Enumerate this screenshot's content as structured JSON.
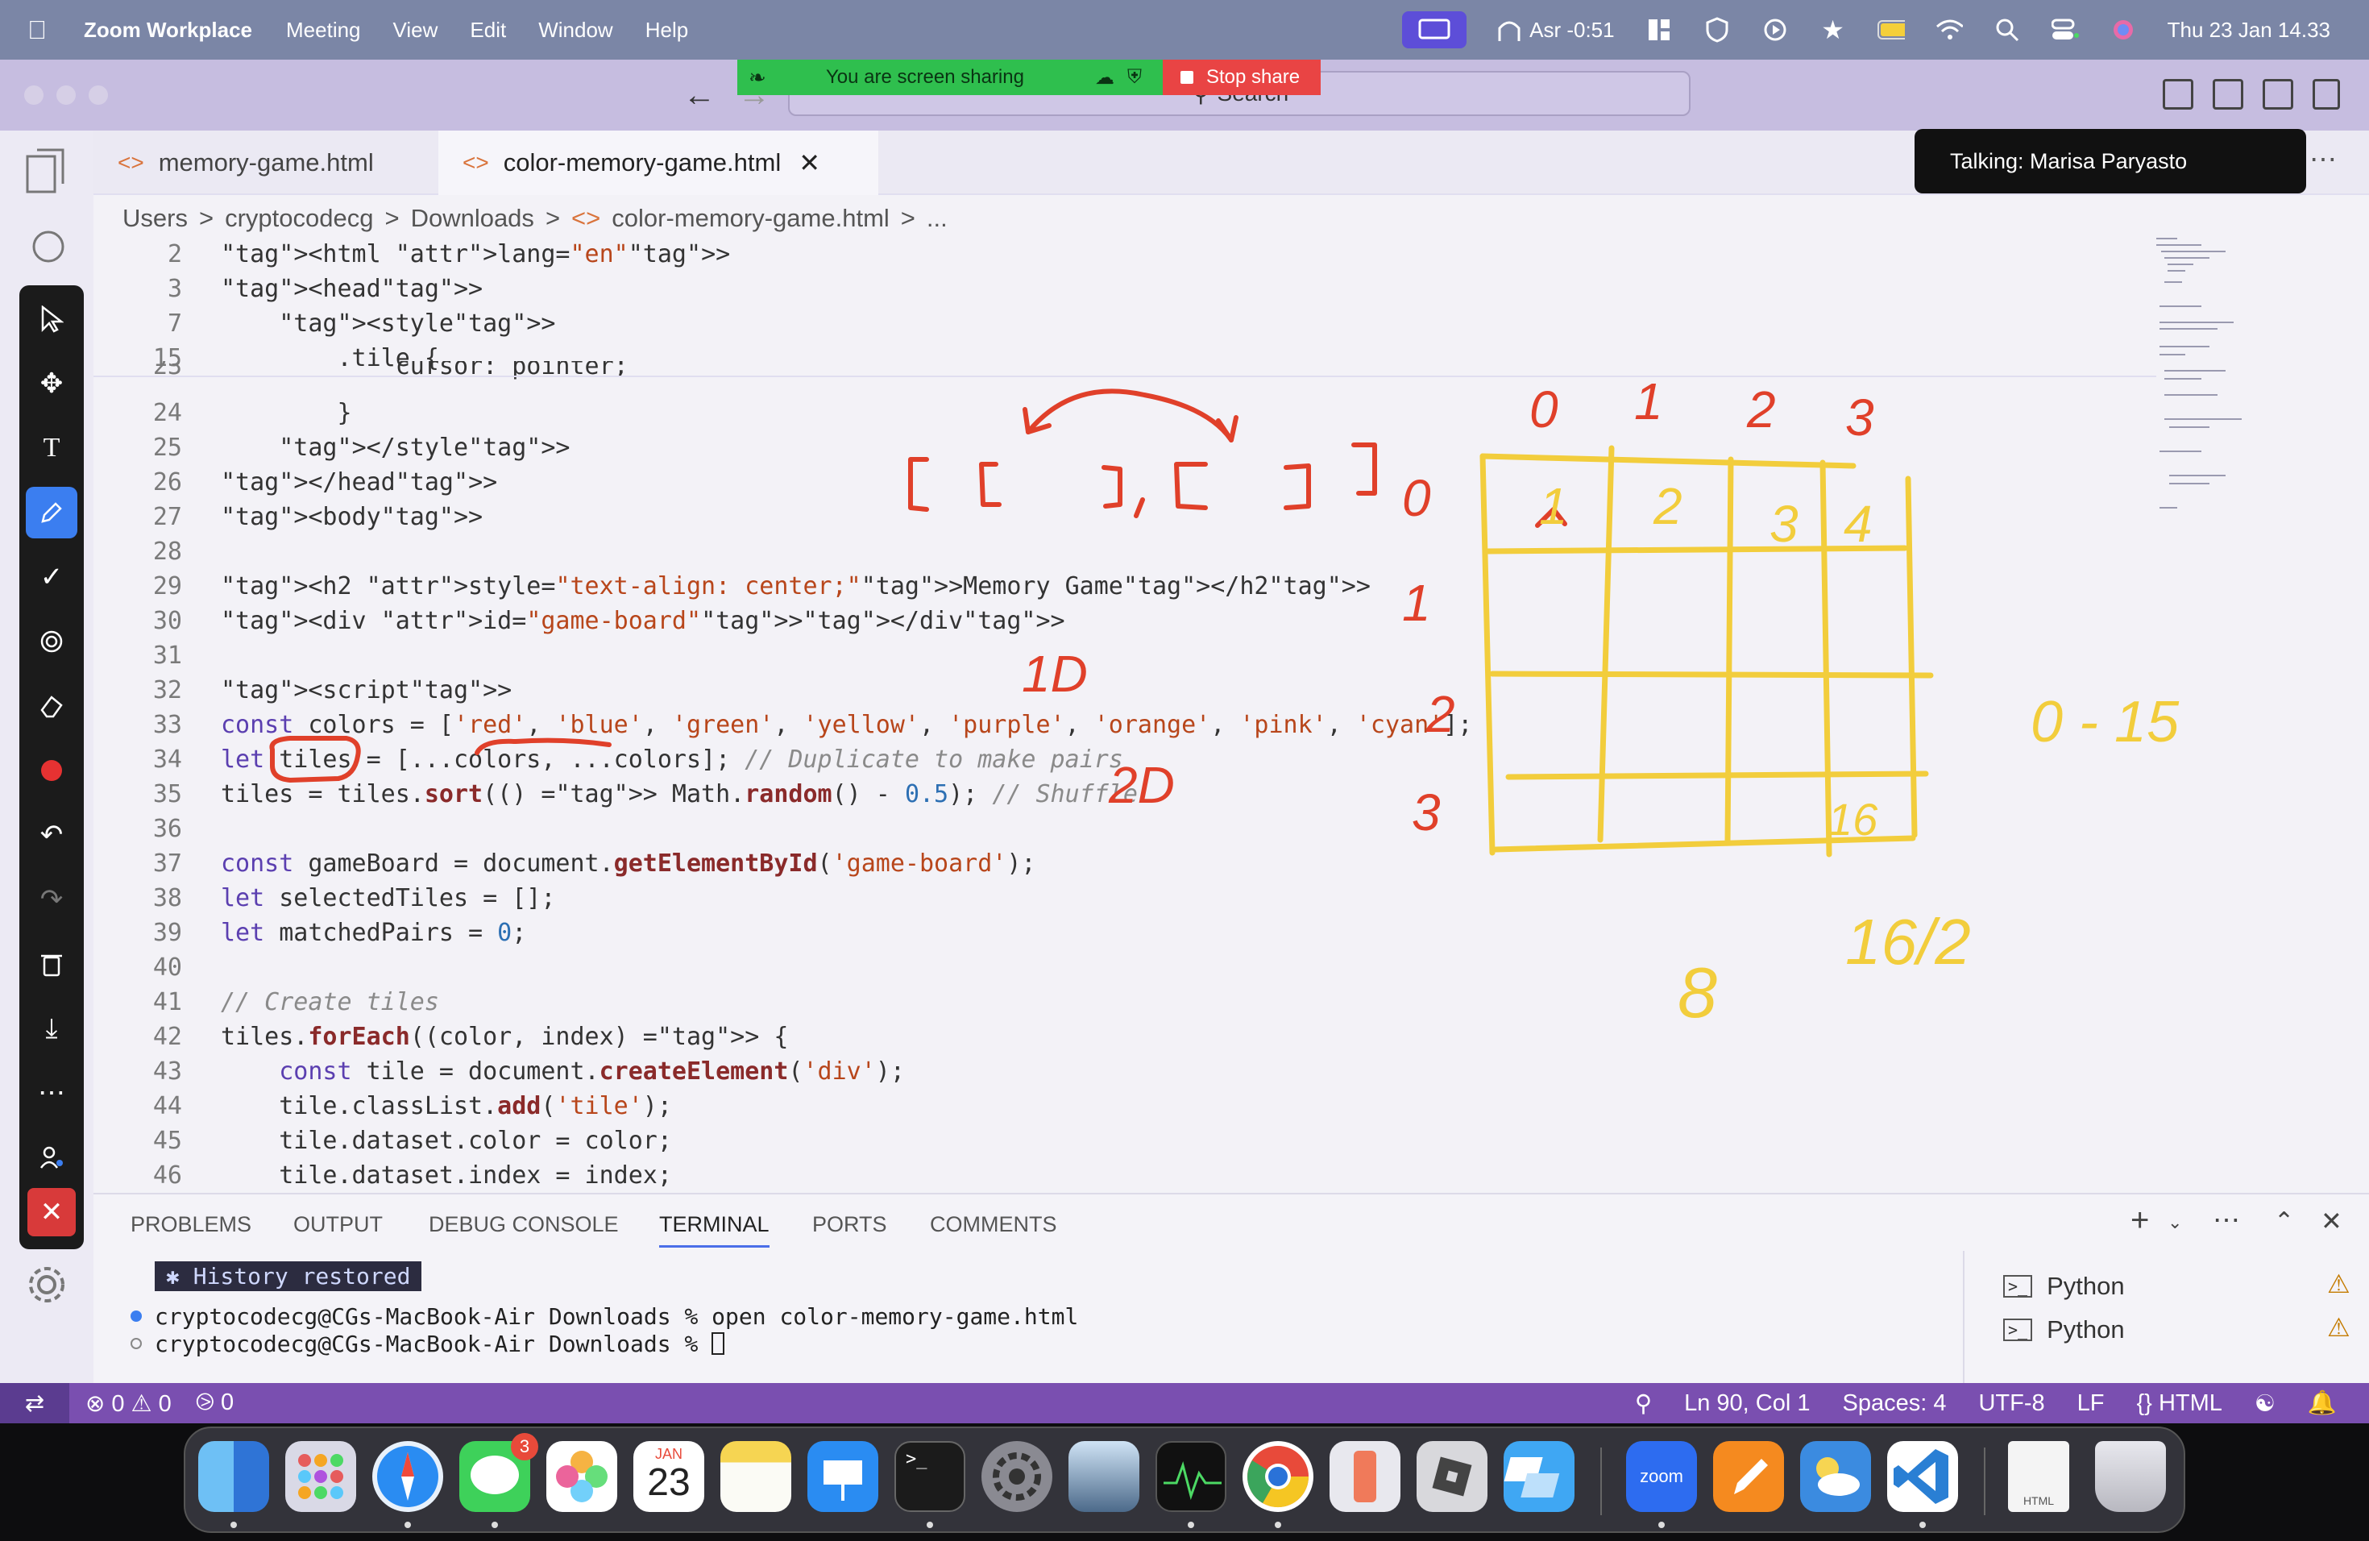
{
  "menubar": {
    "app_name": "Zoom Workplace",
    "menus": [
      "Meeting",
      "View",
      "Edit",
      "Window",
      "Help"
    ],
    "prayer_time": "Asr -0:51",
    "datetime": "Thu 23 Jan  14.33"
  },
  "titlebar": {
    "search_placeholder": "Search"
  },
  "share": {
    "banner_text": "You are screen sharing",
    "stop_label": "Stop share"
  },
  "tabs": [
    {
      "label": "memory-game.html",
      "active": false
    },
    {
      "label": "color-memory-game.html",
      "active": true
    }
  ],
  "talking": "Talking: Marisa Paryasto",
  "breadcrumb": [
    "Users",
    ">",
    "cryptocodecg",
    ">",
    "Downloads",
    ">",
    "color-memory-game.html",
    ">",
    "..."
  ],
  "editor": {
    "lines": [
      {
        "n": "2",
        "code": "<html lang=\"en\">"
      },
      {
        "n": "3",
        "code": "<head>"
      },
      {
        "n": "7",
        "code": "    <style>"
      },
      {
        "n": "15",
        "code": "        .tile {"
      },
      {
        "n": "23",
        "code": "            cursor: pointer;"
      },
      {
        "n": "24",
        "code": "        }"
      },
      {
        "n": "25",
        "code": "    </style>"
      },
      {
        "n": "26",
        "code": "</head>"
      },
      {
        "n": "27",
        "code": "<body>"
      },
      {
        "n": "28",
        "code": ""
      },
      {
        "n": "29",
        "code": "<h2 style=\"text-align: center;\">Memory Game</h2>"
      },
      {
        "n": "30",
        "code": "<div id=\"game-board\"></div>"
      },
      {
        "n": "31",
        "code": ""
      },
      {
        "n": "32",
        "code": "<script>"
      },
      {
        "n": "33",
        "code": "const colors = ['red', 'blue', 'green', 'yellow', 'purple', 'orange', 'pink', 'cyan'];"
      },
      {
        "n": "34",
        "code": "let tiles = [...colors, ...colors]; // Duplicate to make pairs"
      },
      {
        "n": "35",
        "code": "tiles = tiles.sort(() => Math.random() - 0.5); // Shuffle"
      },
      {
        "n": "36",
        "code": ""
      },
      {
        "n": "37",
        "code": "const gameBoard = document.getElementById('game-board');"
      },
      {
        "n": "38",
        "code": "let selectedTiles = [];"
      },
      {
        "n": "39",
        "code": "let matchedPairs = 0;"
      },
      {
        "n": "40",
        "code": ""
      },
      {
        "n": "41",
        "code": "// Create tiles"
      },
      {
        "n": "42",
        "code": "tiles.forEach((color, index) => {"
      },
      {
        "n": "43",
        "code": "    const tile = document.createElement('div');"
      },
      {
        "n": "44",
        "code": "    tile.classList.add('tile');"
      },
      {
        "n": "45",
        "code": "    tile.dataset.color = color;"
      },
      {
        "n": "46",
        "code": "    tile.dataset.index = index;"
      }
    ]
  },
  "annotations": {
    "brackets": "[ [   ], [   ] ]",
    "label_1d": "1D",
    "label_2d": "2D",
    "col_indices": [
      "0",
      "1",
      "2",
      "3"
    ],
    "row_indices": [
      "0",
      "1",
      "2",
      "3"
    ],
    "cell_labels": [
      "1",
      "2",
      "3",
      "4"
    ],
    "last_cell": "16",
    "range": "0 - 15",
    "half": "16/2",
    "pairs": "8"
  },
  "panel": {
    "tabs": [
      "PROBLEMS",
      "OUTPUT",
      "DEBUG CONSOLE",
      "TERMINAL",
      "PORTS",
      "COMMENTS"
    ],
    "active_tab": "TERMINAL",
    "history": "History restored",
    "terminal_lines": [
      "cryptocodecg@CGs-MacBook-Air Downloads % open color-memory-game.html",
      "cryptocodecg@CGs-MacBook-Air Downloads % "
    ],
    "term_list": [
      "Python",
      "Python"
    ]
  },
  "statusbar": {
    "errors": "0",
    "warnings": "0",
    "ports": "0",
    "position": "Ln 90, Col 1",
    "spaces": "Spaces: 4",
    "encoding": "UTF-8",
    "eol": "LF",
    "language": "HTML"
  },
  "dock": {
    "calendar_month": "JAN",
    "calendar_day": "23",
    "messages_badge": "3",
    "zoom_label": "zoom",
    "file_label": "HTML"
  },
  "colors": {
    "accent": "#7a4fb0",
    "annotation_red": "#e0402a",
    "annotation_yellow": "#f2cd3c"
  }
}
